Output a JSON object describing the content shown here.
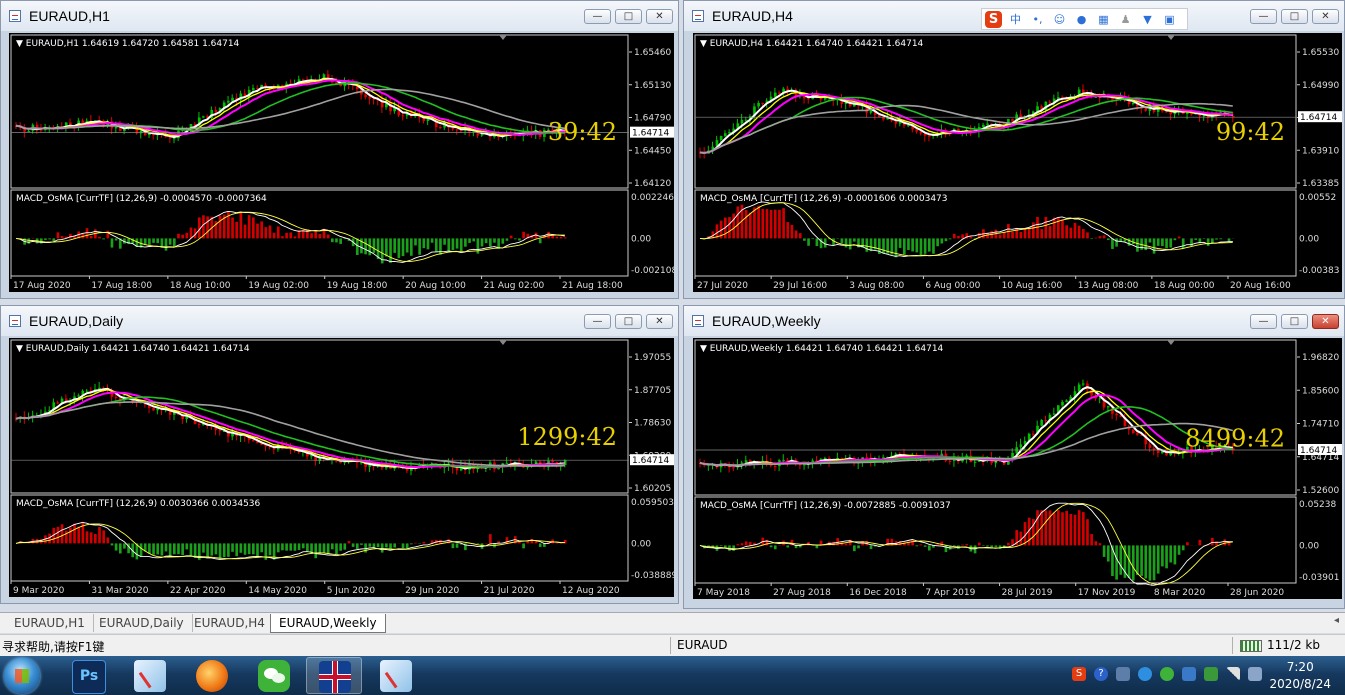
{
  "windows": [
    {
      "title": "EURAUD,H1",
      "buttons": [
        "—",
        "□",
        "✕"
      ],
      "info": "EURAUD,H1  1.64619 1.64720 1.64581 1.64714",
      "countdown": "39:42",
      "price_ticks": [
        "1.65460",
        "1.65130",
        "1.64790",
        "1.64450",
        "1.64120"
      ],
      "current_price": "1.64714",
      "macd_label": "MACD_OsMA [CurrTF] (12,26,9) -0.0004570 -0.0007364",
      "macd_ticks": [
        "0.0022461",
        "0.00",
        "-0.002108"
      ],
      "time_ticks": [
        "17 Aug 2020",
        "17 Aug 18:00",
        "18 Aug 10:00",
        "19 Aug 02:00",
        "19 Aug 18:00",
        "20 Aug 10:00",
        "21 Aug 02:00",
        "21 Aug 18:00"
      ]
    },
    {
      "title": "EURAUD,H4",
      "buttons": [
        "—",
        "□",
        "✕"
      ],
      "info": "EURAUD,H4  1.64421 1.64740 1.64421 1.64714",
      "countdown": "99:42",
      "price_ticks": [
        "1.65530",
        "1.64990",
        "1.64450",
        "1.63910",
        "1.63385"
      ],
      "current_price": "1.64714",
      "macd_label": "MACD_OsMA [CurrTF] (12,26,9) -0.0001606 0.0003473",
      "macd_ticks": [
        "0.00552",
        "0.00",
        "-0.00383"
      ],
      "time_ticks": [
        "27 Jul 2020",
        "29 Jul 16:00",
        "3 Aug 08:00",
        "6 Aug 00:00",
        "10 Aug 16:00",
        "13 Aug 08:00",
        "18 Aug 00:00",
        "20 Aug 16:00"
      ]
    },
    {
      "title": "EURAUD,Daily",
      "buttons": [
        "—",
        "□",
        "✕"
      ],
      "info": "EURAUD,Daily  1.64421 1.64740 1.64421 1.64714",
      "countdown": "1299:42",
      "price_ticks": [
        "1.97055",
        "1.87705",
        "1.78630",
        "1.69280",
        "1.60205"
      ],
      "current_price": "1.64714",
      "macd_label": "MACD_OsMA [CurrTF] (12,26,9) 0.0030366 0.0034536",
      "macd_ticks": [
        "0.0595038",
        "0.00",
        "-0.038889"
      ],
      "time_ticks": [
        "9 Mar 2020",
        "31 Mar 2020",
        "22 Apr 2020",
        "14 May 2020",
        "5 Jun 2020",
        "29 Jun 2020",
        "21 Jul 2020",
        "12 Aug 2020"
      ]
    },
    {
      "title": "EURAUD,Weekly",
      "buttons": [
        "—",
        "□",
        "✕"
      ],
      "info": "EURAUD,Weekly  1.64421 1.64740 1.64421 1.64714",
      "countdown": "8499:42",
      "price_ticks": [
        "1.96820",
        "1.85600",
        "1.74710",
        "1.64714",
        "1.52600"
      ],
      "current_price": "1.64714",
      "macd_label": "MACD_OsMA [CurrTF] (12,26,9) -0.0072885 -0.0091037",
      "macd_ticks": [
        "0.05238",
        "0.00",
        "-0.03901"
      ],
      "time_ticks": [
        "7 May 2018",
        "27 Aug 2018",
        "16 Dec 2018",
        "7 Apr 2019",
        "28 Jul 2019",
        "17 Nov 2019",
        "8 Mar 2020",
        "28 Jun 2020"
      ]
    }
  ],
  "tabs": [
    "EURAUD,H1",
    "EURAUD,Daily",
    "EURAUD,H4",
    "EURAUD,Weekly"
  ],
  "active_tab": "EURAUD,Weekly",
  "status": {
    "help": "寻求帮助,请按F1键",
    "symbol": "EURAUD",
    "traffic": "111/2 kb"
  },
  "ime_toolbar": {
    "logo": "S",
    "lang": "中"
  },
  "clock": {
    "time": "7:20",
    "date": "2020/8/24"
  },
  "colors": {
    "bull": "#00c000",
    "bear": "#e00000",
    "ma_white": "#ffffff",
    "ma_yellow": "#ffff00",
    "ma_magenta": "#ff00ff",
    "ma_green": "#20c020",
    "ma_gray": "#a0a0a0",
    "countdown": "#e8d000"
  }
}
